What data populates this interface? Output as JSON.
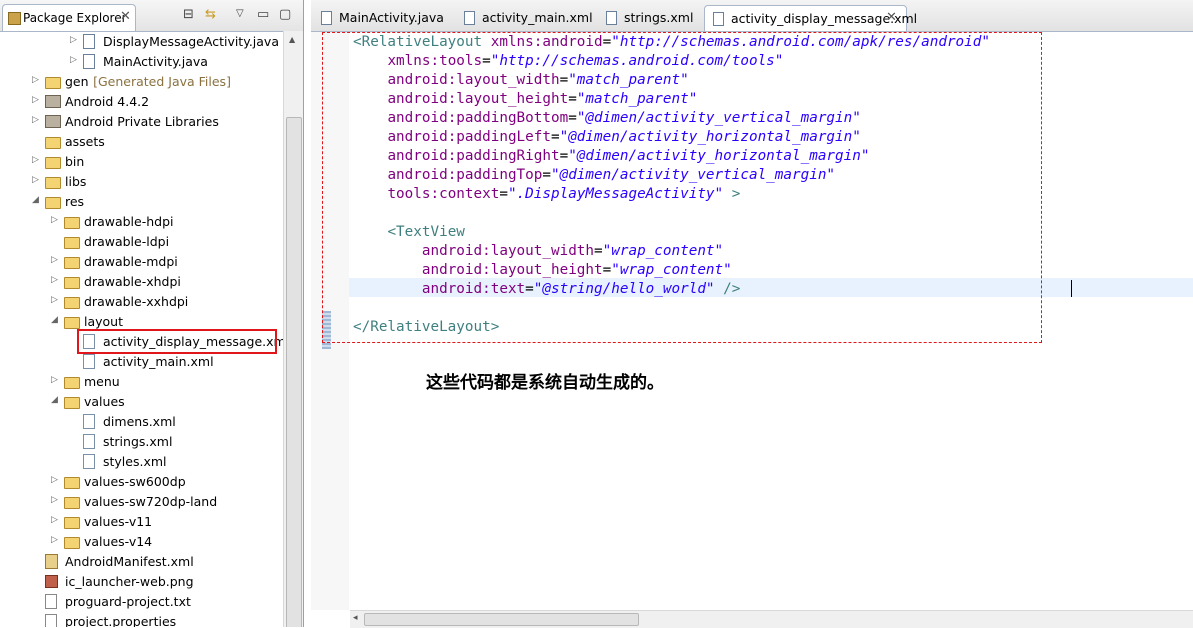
{
  "package_explorer": {
    "title": "Package Explorer",
    "tree": [
      {
        "label": "DisplayMessageActivity.java",
        "icon": "java-file-icon",
        "depth": 3,
        "arrow": "collapsed"
      },
      {
        "label": "MainActivity.java",
        "icon": "java-file-icon",
        "depth": 3,
        "arrow": "collapsed"
      },
      {
        "label": "gen",
        "decoration": "[Generated Java Files]",
        "icon": "folder-icon",
        "depth": 1,
        "arrow": "collapsed"
      },
      {
        "label": "Android 4.4.2",
        "icon": "library-icon",
        "depth": 1,
        "arrow": "collapsed"
      },
      {
        "label": "Android Private Libraries",
        "icon": "library-icon",
        "depth": 1,
        "arrow": "collapsed"
      },
      {
        "label": "assets",
        "icon": "folder-icon",
        "depth": 1,
        "arrow": "none"
      },
      {
        "label": "bin",
        "icon": "folder-icon",
        "depth": 1,
        "arrow": "collapsed"
      },
      {
        "label": "libs",
        "icon": "folder-icon",
        "depth": 1,
        "arrow": "collapsed"
      },
      {
        "label": "res",
        "icon": "folder-icon",
        "depth": 1,
        "arrow": "expanded"
      },
      {
        "label": "drawable-hdpi",
        "icon": "folder-icon",
        "depth": 2,
        "arrow": "collapsed"
      },
      {
        "label": "drawable-ldpi",
        "icon": "folder-icon",
        "depth": 2,
        "arrow": "none"
      },
      {
        "label": "drawable-mdpi",
        "icon": "folder-icon",
        "depth": 2,
        "arrow": "collapsed"
      },
      {
        "label": "drawable-xhdpi",
        "icon": "folder-icon",
        "depth": 2,
        "arrow": "collapsed"
      },
      {
        "label": "drawable-xxhdpi",
        "icon": "folder-icon",
        "depth": 2,
        "arrow": "collapsed"
      },
      {
        "label": "layout",
        "icon": "folder-icon",
        "depth": 2,
        "arrow": "expanded"
      },
      {
        "label": "activity_display_message.xml",
        "icon": "xml-file-icon",
        "depth": 3,
        "arrow": "none",
        "selected": true
      },
      {
        "label": "activity_main.xml",
        "icon": "xml-file-icon",
        "depth": 3,
        "arrow": "none"
      },
      {
        "label": "menu",
        "icon": "folder-icon",
        "depth": 2,
        "arrow": "collapsed"
      },
      {
        "label": "values",
        "icon": "folder-icon",
        "depth": 2,
        "arrow": "expanded"
      },
      {
        "label": "dimens.xml",
        "icon": "xml-file-icon",
        "depth": 3,
        "arrow": "none"
      },
      {
        "label": "strings.xml",
        "icon": "xml-file-icon",
        "depth": 3,
        "arrow": "none"
      },
      {
        "label": "styles.xml",
        "icon": "xml-file-icon",
        "depth": 3,
        "arrow": "none"
      },
      {
        "label": "values-sw600dp",
        "icon": "folder-icon",
        "depth": 2,
        "arrow": "collapsed"
      },
      {
        "label": "values-sw720dp-land",
        "icon": "folder-icon",
        "depth": 2,
        "arrow": "collapsed"
      },
      {
        "label": "values-v11",
        "icon": "folder-icon",
        "depth": 2,
        "arrow": "collapsed"
      },
      {
        "label": "values-v14",
        "icon": "folder-icon",
        "depth": 2,
        "arrow": "collapsed"
      },
      {
        "label": "AndroidManifest.xml",
        "icon": "manifest-icon",
        "depth": 1,
        "arrow": "none"
      },
      {
        "label": "ic_launcher-web.png",
        "icon": "image-file-icon",
        "depth": 1,
        "arrow": "none"
      },
      {
        "label": "proguard-project.txt",
        "icon": "text-file-icon",
        "depth": 1,
        "arrow": "none"
      },
      {
        "label": "project.properties",
        "icon": "text-file-icon",
        "depth": 1,
        "arrow": "none"
      }
    ]
  },
  "editor": {
    "tabs": [
      {
        "label": "MainActivity.java",
        "icon": "java-file-icon",
        "active": false
      },
      {
        "label": "activity_main.xml",
        "icon": "xml-file-icon",
        "active": false
      },
      {
        "label": "strings.xml",
        "icon": "xml-file-icon",
        "active": false
      },
      {
        "label": "activity_display_message.xml",
        "icon": "xml-file-icon",
        "active": true
      }
    ],
    "code_lines": [
      [
        {
          "t": "tag",
          "s": "<RelativeLayout "
        },
        {
          "t": "attr",
          "s": "xmlns:android"
        },
        {
          "t": "plain",
          "s": "="
        },
        {
          "t": "val",
          "s": "\"http://schemas.android.com/apk/res/android\""
        }
      ],
      [
        {
          "t": "plain",
          "s": "    "
        },
        {
          "t": "attr",
          "s": "xmlns:tools"
        },
        {
          "t": "plain",
          "s": "="
        },
        {
          "t": "val",
          "s": "\"http://schemas.android.com/tools\""
        }
      ],
      [
        {
          "t": "plain",
          "s": "    "
        },
        {
          "t": "attr",
          "s": "android:layout_width"
        },
        {
          "t": "plain",
          "s": "="
        },
        {
          "t": "val",
          "s": "\"match_parent\""
        }
      ],
      [
        {
          "t": "plain",
          "s": "    "
        },
        {
          "t": "attr",
          "s": "android:layout_height"
        },
        {
          "t": "plain",
          "s": "="
        },
        {
          "t": "val",
          "s": "\"match_parent\""
        }
      ],
      [
        {
          "t": "plain",
          "s": "    "
        },
        {
          "t": "attr",
          "s": "android:paddingBottom"
        },
        {
          "t": "plain",
          "s": "="
        },
        {
          "t": "val",
          "s": "\"@dimen/activity_vertical_margin\""
        }
      ],
      [
        {
          "t": "plain",
          "s": "    "
        },
        {
          "t": "attr",
          "s": "android:paddingLeft"
        },
        {
          "t": "plain",
          "s": "="
        },
        {
          "t": "val",
          "s": "\"@dimen/activity_horizontal_margin\""
        }
      ],
      [
        {
          "t": "plain",
          "s": "    "
        },
        {
          "t": "attr",
          "s": "android:paddingRight"
        },
        {
          "t": "plain",
          "s": "="
        },
        {
          "t": "val",
          "s": "\"@dimen/activity_horizontal_margin\""
        }
      ],
      [
        {
          "t": "plain",
          "s": "    "
        },
        {
          "t": "attr",
          "s": "android:paddingTop"
        },
        {
          "t": "plain",
          "s": "="
        },
        {
          "t": "val",
          "s": "\"@dimen/activity_vertical_margin\""
        }
      ],
      [
        {
          "t": "plain",
          "s": "    "
        },
        {
          "t": "attr",
          "s": "tools:context"
        },
        {
          "t": "plain",
          "s": "="
        },
        {
          "t": "val",
          "s": "\".DisplayMessageActivity\""
        },
        {
          "t": "plain",
          "s": " "
        },
        {
          "t": "tag",
          "s": ">"
        }
      ],
      [],
      [
        {
          "t": "plain",
          "s": "    "
        },
        {
          "t": "tag",
          "s": "<TextView"
        }
      ],
      [
        {
          "t": "plain",
          "s": "        "
        },
        {
          "t": "attr",
          "s": "android:layout_width"
        },
        {
          "t": "plain",
          "s": "="
        },
        {
          "t": "val",
          "s": "\"wrap_content\""
        }
      ],
      [
        {
          "t": "plain",
          "s": "        "
        },
        {
          "t": "attr",
          "s": "android:layout_height"
        },
        {
          "t": "plain",
          "s": "="
        },
        {
          "t": "val",
          "s": "\"wrap_content\""
        }
      ],
      [
        {
          "t": "plain",
          "s": "        "
        },
        {
          "t": "attr",
          "s": "android:text"
        },
        {
          "t": "plain",
          "s": "="
        },
        {
          "t": "val",
          "s": "\"@string/hello_world\""
        },
        {
          "t": "plain",
          "s": " "
        },
        {
          "t": "tag",
          "s": "/>"
        }
      ],
      [],
      [
        {
          "t": "tag",
          "s": "</RelativeLayout>"
        }
      ]
    ]
  },
  "annotation": "这些代码都是系统自动生成的。",
  "colors": {
    "highlight_red": "#e0161b",
    "xml_tag": "#3f7f7f",
    "xml_attr": "#7f007f",
    "xml_value": "#2a00ff",
    "current_line": "#e8f2fe"
  }
}
